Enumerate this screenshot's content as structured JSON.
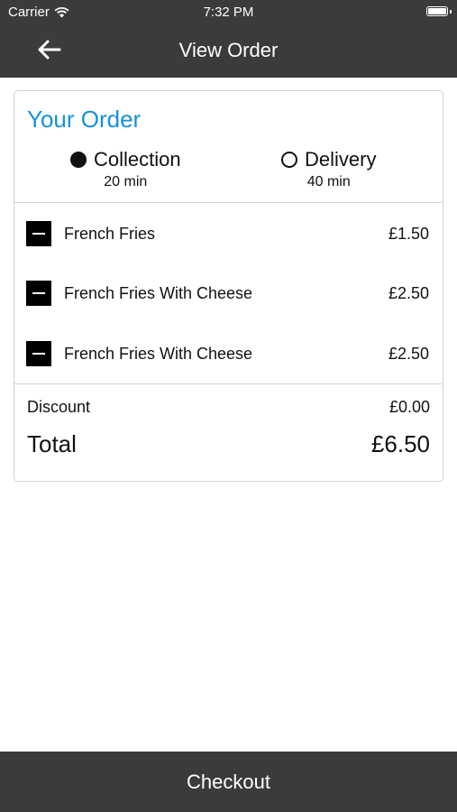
{
  "status_bar": {
    "carrier": "Carrier",
    "time": "7:32 PM"
  },
  "nav": {
    "title": "View Order",
    "back_icon": "arrow-left-icon"
  },
  "order": {
    "heading": "Your Order",
    "options": [
      {
        "label": "Collection",
        "time": "20 min",
        "selected": true
      },
      {
        "label": "Delivery",
        "time": "40 min",
        "selected": false
      }
    ],
    "items": [
      {
        "name": "French Fries",
        "price": "£1.50"
      },
      {
        "name": "French Fries With Cheese",
        "price": "£2.50"
      },
      {
        "name": "French Fries With Cheese",
        "price": "£2.50"
      }
    ],
    "discount_label": "Discount",
    "discount_value": "£0.00",
    "total_label": "Total",
    "total_value": "£6.50"
  },
  "checkout_label": "Checkout",
  "colors": {
    "bar": "#3a3b3c",
    "accent": "#1592d7",
    "border": "#cfd1d3"
  }
}
